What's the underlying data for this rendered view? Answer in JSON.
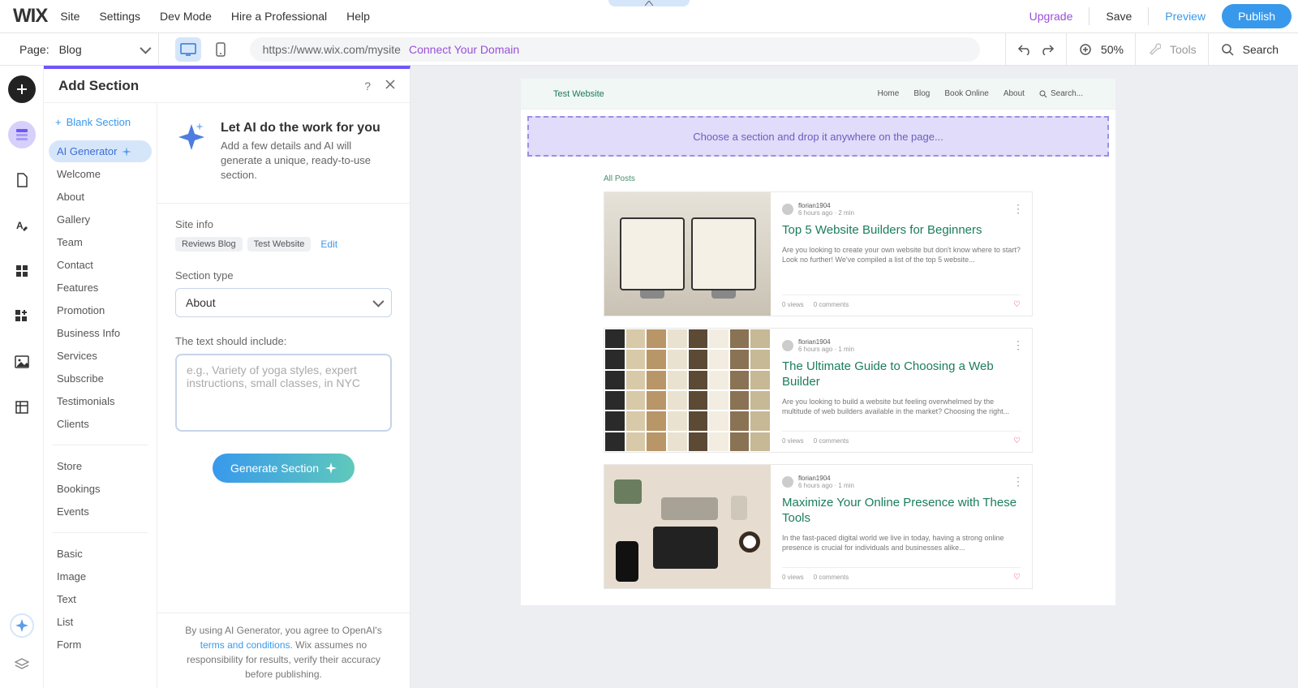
{
  "menubar": {
    "logo": "WIX",
    "items": [
      "Site",
      "Settings",
      "Dev Mode",
      "Hire a Professional",
      "Help"
    ],
    "upgrade": "Upgrade",
    "save": "Save",
    "preview": "Preview",
    "publish": "Publish"
  },
  "toolbar": {
    "page_label": "Page:",
    "page_value": "Blog",
    "url": "https://www.wix.com/mysite",
    "connect_domain": "Connect Your Domain",
    "zoom": "50%",
    "tools": "Tools",
    "search": "Search"
  },
  "panel": {
    "title": "Add Section",
    "blank": "Blank Section",
    "nav_groups": [
      [
        "AI Generator",
        "Welcome",
        "About",
        "Gallery",
        "Team",
        "Contact",
        "Features",
        "Promotion",
        "Business Info",
        "Services",
        "Subscribe",
        "Testimonials",
        "Clients"
      ],
      [
        "Store",
        "Bookings",
        "Events"
      ],
      [
        "Basic",
        "Image",
        "Text",
        "List",
        "Form"
      ]
    ],
    "active_nav": "AI Generator",
    "hero": {
      "title": "Let AI do the work for you",
      "desc": "Add a few details and AI will generate a unique, ready-to-use section."
    },
    "form": {
      "site_info_label": "Site info",
      "chips": [
        "Reviews Blog",
        "Test Website"
      ],
      "edit": "Edit",
      "section_type_label": "Section type",
      "section_type_value": "About",
      "text_include_label": "The text should include:",
      "text_placeholder": "e.g., Variety of yoga styles, expert instructions, small classes, in NYC",
      "generate": "Generate Section"
    },
    "disclaimer_pre": "By using AI Generator, you agree to OpenAI's ",
    "disclaimer_link": "terms and conditions",
    "disclaimer_post": ". Wix assumes no responsibility for results, verify their accuracy before publishing."
  },
  "preview": {
    "site_title": "Test Website",
    "nav": [
      "Home",
      "Blog",
      "Book Online",
      "About"
    ],
    "nav_search": "Search...",
    "dropzone": "Choose a section and drop it anywhere on the page...",
    "all_posts": "All Posts",
    "posts": [
      {
        "author": "florian1904",
        "meta": "6 hours ago · 2 min",
        "title": "Top 5 Website Builders for Beginners",
        "excerpt": "Are you looking to create your own website but don't know where to start? Look no further! We've compiled a list of the top 5 website...",
        "views": "0 views",
        "comments": "0 comments"
      },
      {
        "author": "florian1904",
        "meta": "6 hours ago · 1 min",
        "title": "The Ultimate Guide to Choosing a Web Builder",
        "excerpt": "Are you looking to build a website but feeling overwhelmed by the multitude of web builders available in the market? Choosing the right...",
        "views": "0 views",
        "comments": "0 comments"
      },
      {
        "author": "florian1904",
        "meta": "6 hours ago · 1 min",
        "title": "Maximize Your Online Presence with These Tools",
        "excerpt": "In the fast-paced digital world we live in today, having a strong online presence is crucial for individuals and businesses alike...",
        "views": "0 views",
        "comments": "0 comments"
      }
    ]
  }
}
